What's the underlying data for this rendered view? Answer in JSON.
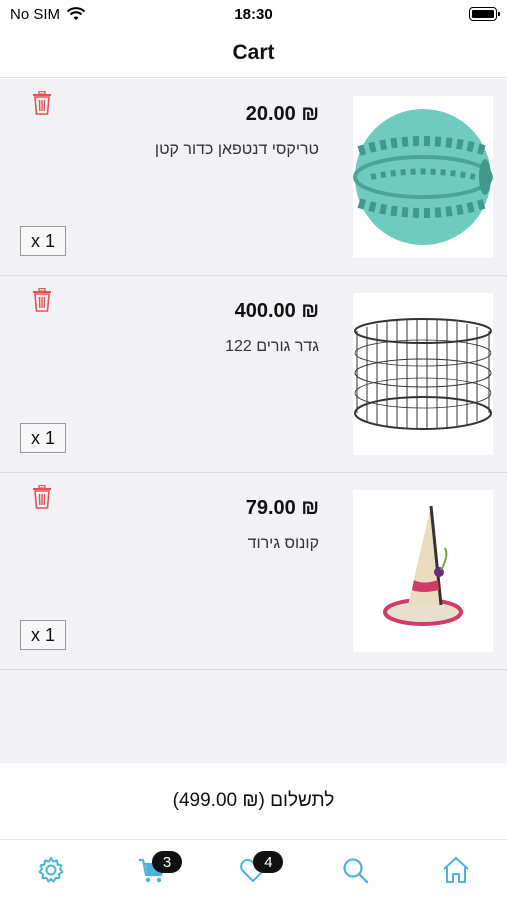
{
  "status_bar": {
    "carrier": "No SIM",
    "time": "18:30"
  },
  "header": {
    "title": "Cart"
  },
  "cart": {
    "items": [
      {
        "price": "₪ 20.00",
        "name": "טריקסי דנטפאן כדור קטן",
        "qty_label": "x 1",
        "image_icon": "dental-ball-toy"
      },
      {
        "price": "₪ 400.00",
        "name": "גדר גורים 122",
        "qty_label": "x 1",
        "image_icon": "puppy-fence"
      },
      {
        "price": "₪ 79.00",
        "name": "קונוס גירוד",
        "qty_label": "x 1",
        "image_icon": "cat-scratch-cone"
      }
    ]
  },
  "total": {
    "label": "לתשלום (₪ 499.00)"
  },
  "tab_bar": {
    "accent_color": "#4fb3d9",
    "tabs": [
      {
        "icon": "gear-icon"
      },
      {
        "icon": "cart-icon",
        "badge": "3"
      },
      {
        "icon": "heart-icon",
        "badge": "4"
      },
      {
        "icon": "search-icon"
      },
      {
        "icon": "home-icon"
      }
    ]
  },
  "colors": {
    "trash": "#e05555",
    "list_bg": "#f2f2f4"
  }
}
